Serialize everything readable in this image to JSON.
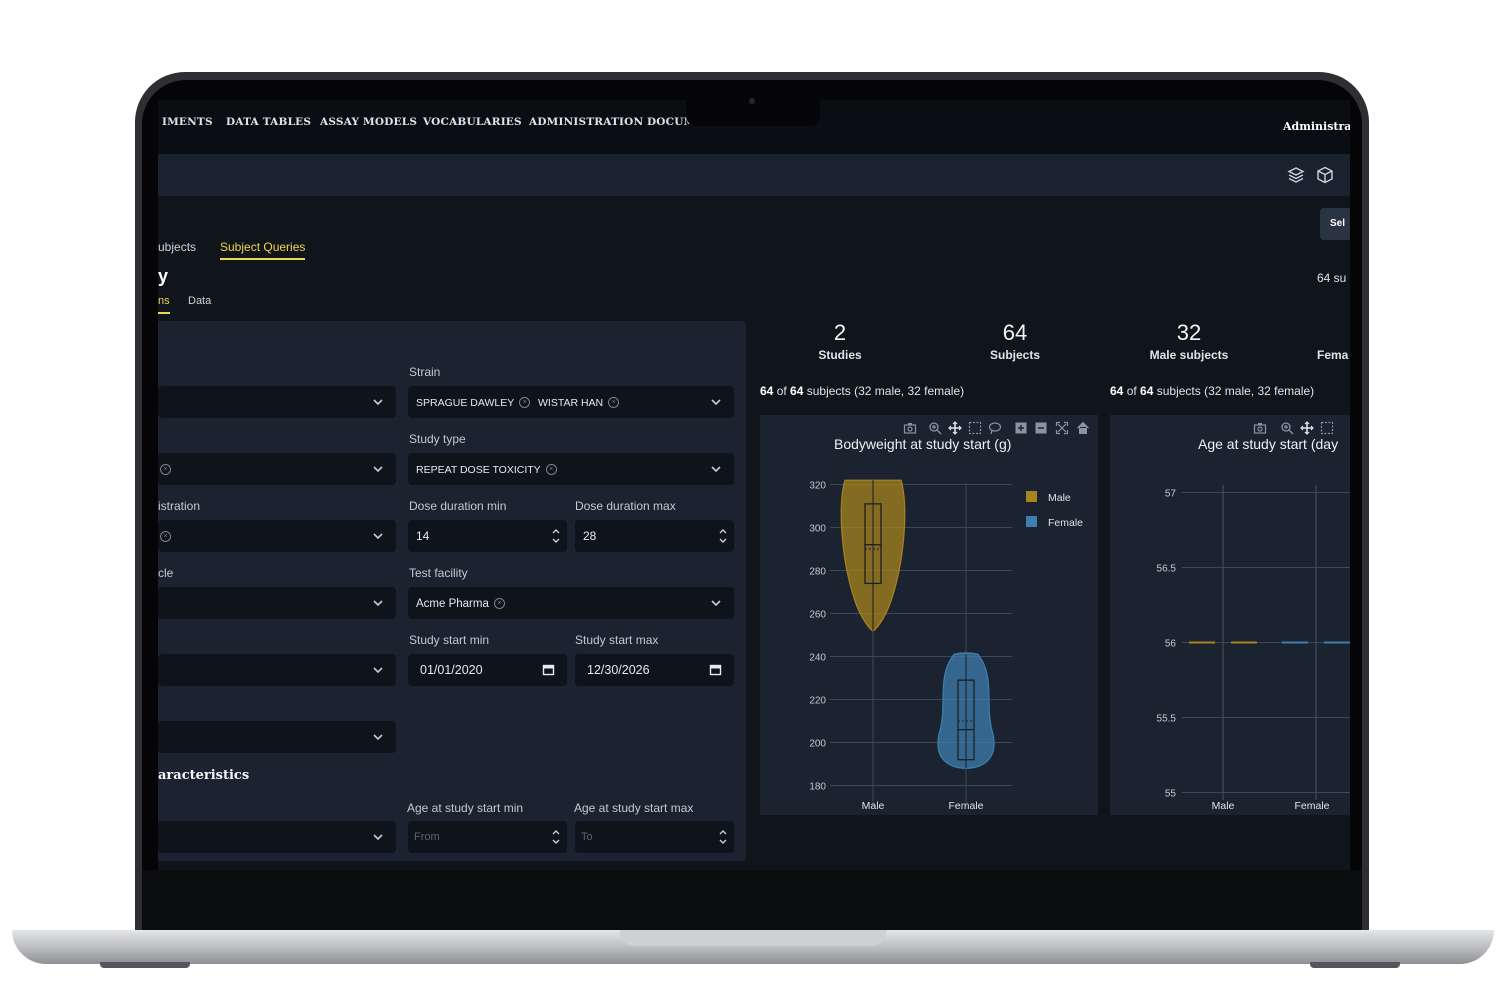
{
  "nav": {
    "items": [
      "IMENTS",
      "DATA TABLES",
      "ASSAY MODELS",
      "VOCABULARIES",
      "ADMINISTRATION",
      "DOCUMENTATION"
    ],
    "user": "Administra"
  },
  "toolbar": {
    "icons": [
      "layers-icon",
      "cube-icon"
    ]
  },
  "tabs": {
    "subjects": "ubjects",
    "subject_queries": "Subject Queries"
  },
  "page": {
    "title": "y",
    "subtabs": [
      "ns",
      "Data"
    ],
    "select_label": "Sel",
    "count_label": "64 su"
  },
  "filters": {
    "strain_label": "Strain",
    "strain_chips": [
      "SPRAGUE DAWLEY",
      "WISTAR HAN"
    ],
    "study_type_label": "Study type",
    "study_type_chips": [
      "REPEAT DOSE TOXICITY"
    ],
    "route_label": "istration",
    "dose_min_label": "Dose duration min",
    "dose_min_value": "14",
    "dose_max_label": "Dose duration max",
    "dose_max_value": "28",
    "vehicle_label": "cle",
    "facility_label": "Test facility",
    "facility_chips": [
      "Acme Pharma"
    ],
    "start_min_label": "Study start min",
    "start_min_value": "01/01/2020",
    "start_max_label": "Study start max",
    "start_max_value": "12/30/2026",
    "characteristics_title": "aracteristics",
    "age_min_label": "Age at study start min",
    "age_min_placeholder": "From",
    "age_max_label": "Age at study start max",
    "age_max_placeholder": "To"
  },
  "stats": [
    {
      "value": "2",
      "label": "Studies"
    },
    {
      "value": "64",
      "label": "Subjects"
    },
    {
      "value": "32",
      "label": "Male subjects"
    },
    {
      "value": "",
      "label": "Fema"
    }
  ],
  "summary": {
    "bold1": "64",
    "mid": " of ",
    "bold2": "64",
    "rest": " subjects (32 male, 32 female)"
  },
  "colors": {
    "male": "#a8841e",
    "female": "#3f7fae",
    "accent": "#f0d64a"
  },
  "chart_data": [
    {
      "type": "violin",
      "title": "Bodyweight at study start (g)",
      "categories": [
        "Male",
        "Female"
      ],
      "ylim": [
        170,
        330
      ],
      "yticks": [
        180,
        200,
        220,
        240,
        260,
        280,
        300,
        320
      ],
      "legend": [
        "Male",
        "Female"
      ],
      "legend_position": "top-right",
      "series": [
        {
          "name": "Male",
          "min": 252,
          "q1": 274,
          "median": 292,
          "mean": 290,
          "q3": 311,
          "max": 322
        },
        {
          "name": "Female",
          "min": 188,
          "q1": 192,
          "median": 206,
          "mean": 210,
          "q3": 229,
          "max": 241
        }
      ]
    },
    {
      "type": "violin",
      "title": "Age at study start (day",
      "categories": [
        "Male",
        "Female"
      ],
      "ylim": [
        54.95,
        57.05
      ],
      "yticks": [
        55,
        55.5,
        56,
        56.5,
        57
      ],
      "series": [
        {
          "name": "Male",
          "value": 56
        },
        {
          "name": "Female",
          "value": 56
        }
      ]
    }
  ]
}
